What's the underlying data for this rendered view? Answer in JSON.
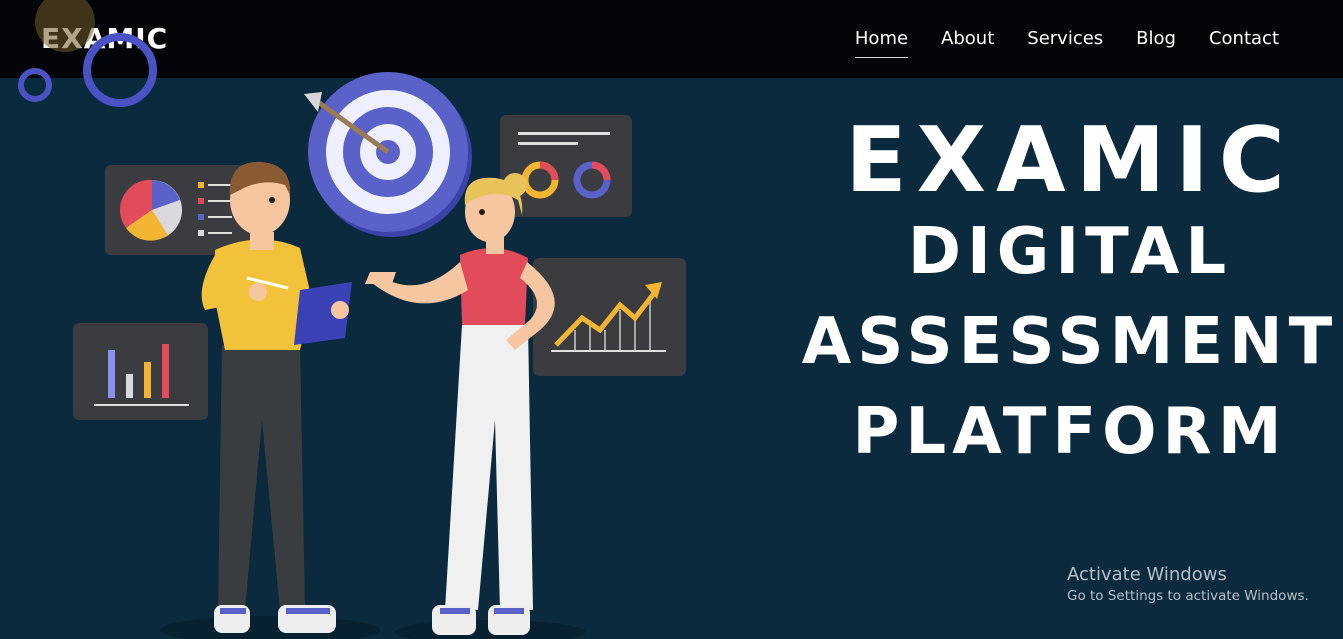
{
  "nav": {
    "brand": "EXAMIC",
    "links": [
      "Home",
      "About",
      "Services",
      "Blog",
      "Contact"
    ]
  },
  "hero": {
    "title": "EXAMIC",
    "subtitle_lines": [
      "DIGITAL",
      "ASSESSMENT",
      "PLATFORM"
    ]
  },
  "watermark": {
    "title": "Activate Windows",
    "subtitle": "Go to Settings to activate Windows."
  },
  "colors": {
    "navbar": "#030508",
    "hero_background": "#0b2a3e",
    "text": "#ffffff",
    "accent_blue": "#5a62c9"
  }
}
